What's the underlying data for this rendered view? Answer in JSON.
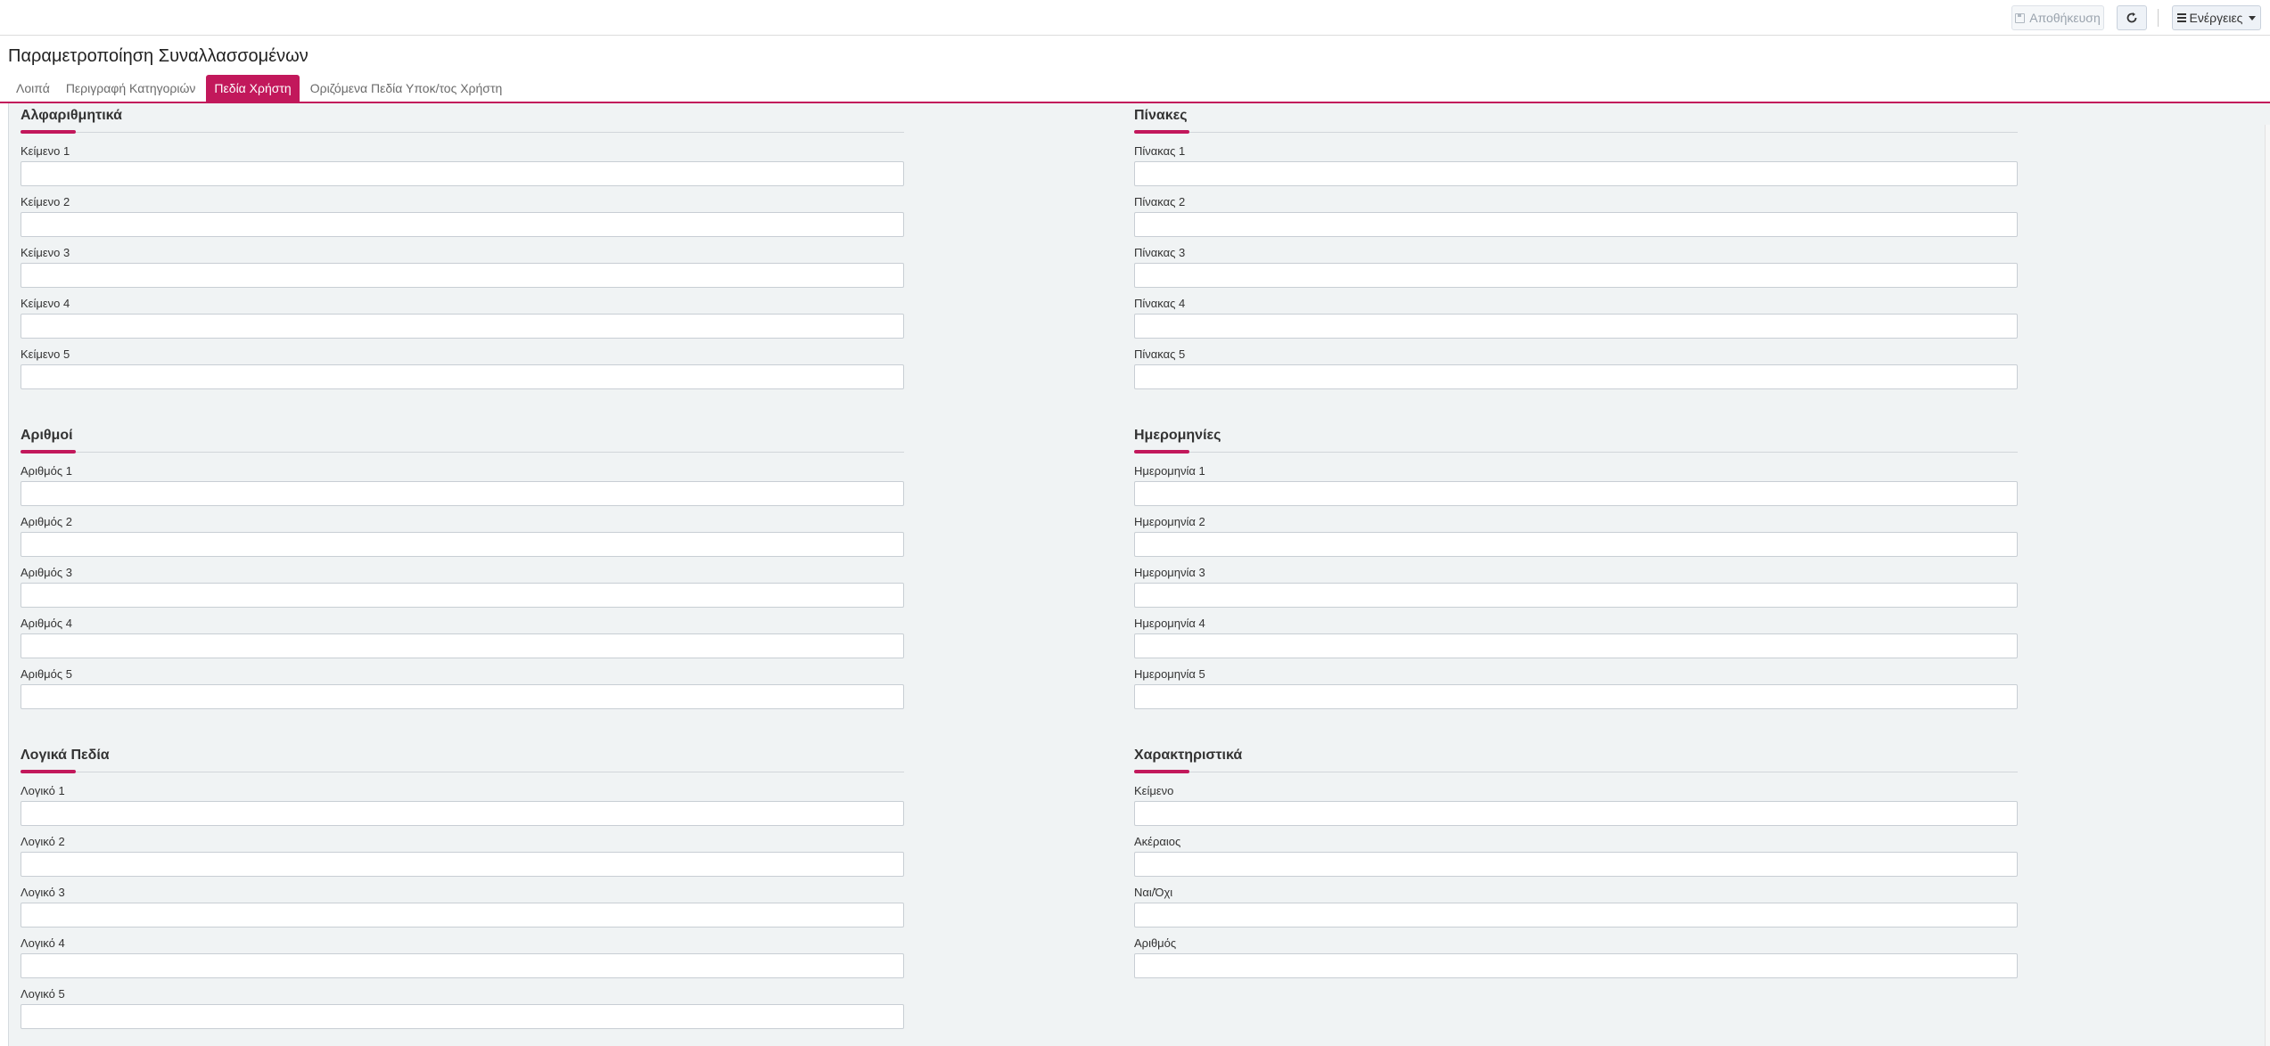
{
  "toolbar": {
    "save_label": "Αποθήκευση",
    "actions_label": "Ενέργειες"
  },
  "page": {
    "title": "Παραμετροποίηση Συναλλασσομένων"
  },
  "tabs": [
    {
      "label": "Λοιπά",
      "active": false
    },
    {
      "label": "Περιγραφή Κατηγοριών",
      "active": false
    },
    {
      "label": "Πεδία Χρήστη",
      "active": true
    },
    {
      "label": "Οριζόμενα Πεδία Υποκ/τος Χρήστη",
      "active": false
    }
  ],
  "sections": {
    "alphanumeric": {
      "title": "Αλφαριθμητικά",
      "fields": [
        "Κείμενο 1",
        "Κείμενο 2",
        "Κείμενο 3",
        "Κείμενο 4",
        "Κείμενο 5"
      ]
    },
    "tables": {
      "title": "Πίνακες",
      "fields": [
        "Πίνακας 1",
        "Πίνακας 2",
        "Πίνακας 3",
        "Πίνακας 4",
        "Πίνακας 5"
      ]
    },
    "numbers": {
      "title": "Αριθμοί",
      "fields": [
        "Αριθμός 1",
        "Αριθμός 2",
        "Αριθμός 3",
        "Αριθμός 4",
        "Αριθμός 5"
      ]
    },
    "dates": {
      "title": "Ημερομηνίες",
      "fields": [
        "Ημερομηνία 1",
        "Ημερομηνία 2",
        "Ημερομηνία 3",
        "Ημερομηνία 4",
        "Ημερομηνία 5"
      ]
    },
    "logical": {
      "title": "Λογικά Πεδία",
      "fields": [
        "Λογικό 1",
        "Λογικό 2",
        "Λογικό 3",
        "Λογικό 4",
        "Λογικό 5"
      ]
    },
    "characteristics": {
      "title": "Χαρακτηριστικά",
      "fields": [
        "Κείμενο",
        "Ακέραιος",
        "Ναι/Όχι",
        "Αριθμός"
      ]
    }
  },
  "colors": {
    "accent": "#c2185b",
    "content_bg": "#f0f3f4"
  }
}
